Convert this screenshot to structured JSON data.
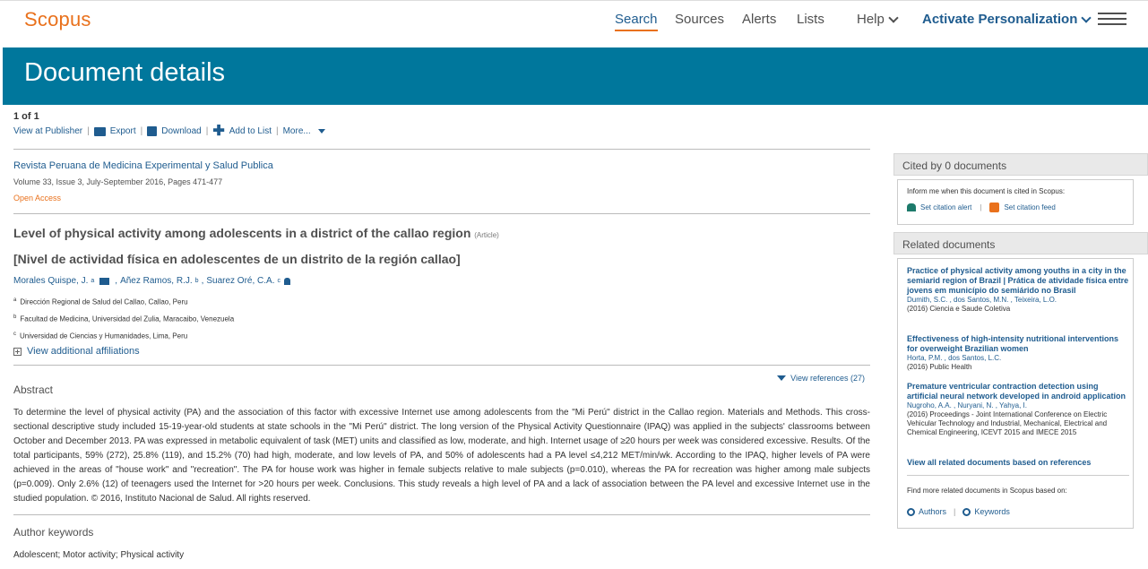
{
  "header": {
    "logo": "Scopus",
    "nav": [
      "Search",
      "Sources",
      "Alerts",
      "Lists"
    ],
    "help": "Help",
    "activate": "Activate Personalization"
  },
  "banner": {
    "title": "Document details"
  },
  "doc": {
    "count": "1 of 1",
    "actions": {
      "view_publisher": "View at Publisher",
      "export": "Export",
      "download": "Download",
      "add_to_list": "Add to List",
      "more": "More..."
    },
    "journal": "Revista Peruana de Medicina Experimental y Salud Publica",
    "volume": "Volume 33, Issue 3, July-September 2016, Pages 471-477",
    "open_access": "Open Access",
    "title": "Level of physical activity among adolescents in a district of the callao region",
    "type": "(Article)",
    "title_alt": "[Nivel de actividad física en adolescentes de un distrito de la región callao]",
    "authors": [
      {
        "name": "Morales Quispe, J.",
        "sup": "a"
      },
      {
        "name": "Añez Ramos, R.J.",
        "sup": "b"
      },
      {
        "name": "Suarez Oré, C.A.",
        "sup": "c"
      }
    ],
    "affiliations": [
      {
        "sup": "a",
        "text": "Dirección Regional de Salud del Callao, Callao, Peru"
      },
      {
        "sup": "b",
        "text": "Facultad de Medicina, Universidad del Zulia, Maracaibo, Venezuela"
      },
      {
        "sup": "c",
        "text": "Universidad de Ciencias y Humanidades, Lima, Peru"
      }
    ],
    "view_affiliations": "View additional affiliations",
    "view_references": "View references (27)",
    "abstract_heading": "Abstract",
    "abstract": "To determine the level of physical activity (PA) and the association of this factor with excessive Internet use among adolescents from the \"Mi Perú\" district in the Callao region. Materials and Methods. This cross-sectional descriptive study included 15-19-year-old students at state schools in the \"Mi Perú\" district. The long version of the Physical Activity Questionnaire (IPAQ) was applied in the subjects' classrooms between October and December 2013. PA was expressed in metabolic equivalent of task (MET) units and classified as low, moderate, and high. Internet usage of ≥20 hours per week was considered excessive. Results. Of the total participants, 59% (272), 25.8% (119), and 15.2% (70) had high, moderate, and low levels of PA, and 50% of adolescents had a PA level ≤4,212 MET/min/wk. According to the IPAQ, higher levels of PA were achieved in the areas of \"house work\" and \"recreation\". The PA for house work was higher in female subjects relative to male subjects (p=0.010), whereas the PA for recreation was higher among male subjects (p=0.009). Only 2.6% (12) of teenagers used the Internet for >20 hours per week. Conclusions. This study reveals a high level of PA and a lack of association between the PA level and excessive Internet use in the studied population. © 2016, Instituto Nacional de Salud. All rights reserved.",
    "keywords_heading": "Author keywords",
    "keywords": "Adolescent; Motor activity; Physical activity"
  },
  "sidebar": {
    "cited": {
      "heading": "Cited by 0 documents",
      "inform": "Inform me when this document is cited in Scopus:",
      "alert": "Set citation alert",
      "feed": "Set citation feed"
    },
    "related": {
      "heading": "Related documents",
      "items": [
        {
          "title": "Practice of physical activity among youths in a city in the semiarid region of Brazil | Prática de atividade física entre jovens em município do semiárido no Brasil",
          "authors": "Dumith, S.C. , dos Santos, M.N. , Teixeira, L.O.",
          "source": "(2016) Ciencia e Saude Coletiva"
        },
        {
          "title": "Effectiveness of high-intensity nutritional interventions for overweight Brazilian women",
          "authors": "Horta, P.M. , dos Santos, L.C.",
          "source": "(2016) Public Health"
        },
        {
          "title": "Premature ventricular contraction detection using artificial neural network developed in android application",
          "authors": "Nugroho, A.A. , Nuryani, N. , Yahya, I.",
          "source": "(2016) Proceedings - Joint International Conference on Electric Vehicular Technology and Industrial, Mechanical, Electrical and Chemical Engineering, ICEVT 2015 and IMECE 2015"
        }
      ],
      "view_all": "View all related documents based on references",
      "find_more": "Find more related documents in Scopus based on:",
      "by_authors": "Authors",
      "by_keywords": "Keywords"
    }
  },
  "colors": {
    "brand": "#e9711c",
    "banner": "#00779c",
    "link": "#1f5c8f"
  }
}
